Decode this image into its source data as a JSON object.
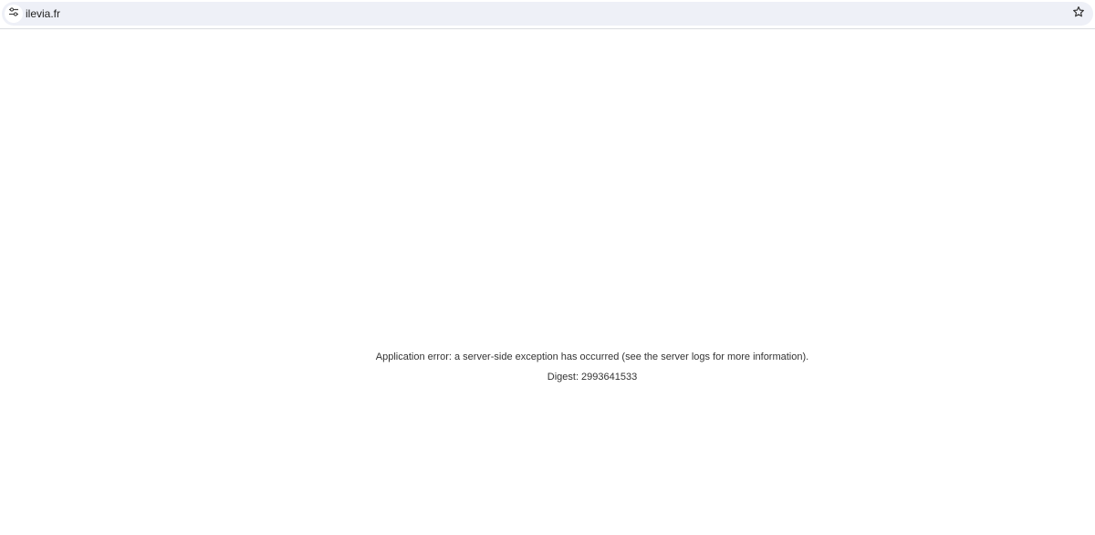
{
  "browser": {
    "url": "ilevia.fr",
    "site_info_icon": "tune-icon",
    "bookmark_icon": "star-outline-icon",
    "omnibox_color": "#eef0f7"
  },
  "page": {
    "error_message": "Application error: a server-side exception has occurred (see the server logs for more information).",
    "digest": "Digest: 2993641533"
  }
}
